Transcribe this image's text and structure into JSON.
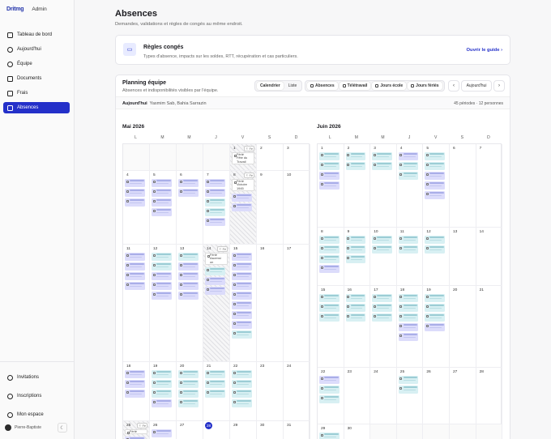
{
  "app": {
    "logo": "Dritmg",
    "section": "Admin"
  },
  "sidebar": {
    "items": [
      {
        "label": "Tableau de bord",
        "icon": "dashboard-icon",
        "active": false
      },
      {
        "label": "Aujourd'hui",
        "icon": "clock-icon",
        "active": false
      },
      {
        "label": "Équipe",
        "icon": "team-icon",
        "active": false
      },
      {
        "label": "Documents",
        "icon": "document-icon",
        "active": false
      },
      {
        "label": "Frais",
        "icon": "receipt-icon",
        "active": false
      },
      {
        "label": "Absences",
        "icon": "calendar-icon",
        "active": true
      }
    ],
    "bottom": [
      {
        "label": "Invitations",
        "icon": "invite-icon"
      },
      {
        "label": "Inscriptions",
        "icon": "signup-icon"
      },
      {
        "label": "Mon espace",
        "icon": "user-icon"
      }
    ],
    "user": "Pierre-Baptiste",
    "theme_icon": "☾"
  },
  "header": {
    "title": "Absences",
    "subtitle": "Demandes, validations et règles de congés au même endroit."
  },
  "rules": {
    "title": "Règles congés",
    "description": "Types d'absence, impacts sur les soldes, RTT, récupération et cas particuliers.",
    "link": "Ouvrir le guide"
  },
  "planning": {
    "title": "Planning équipe",
    "subtitle": "Absences et indisponibilités visibles par l'équipe.",
    "views": [
      "Calendrier",
      "Liste"
    ],
    "filters": [
      "Absences",
      "Télétravail",
      "Jours école",
      "Jours fériés"
    ],
    "today_button": "Aujourd'hui",
    "prev": "‹",
    "next": "›",
    "summary_label": "Aujourd'hui",
    "summary_people": "Yasmim Sab, Bahia Sarrazin",
    "summary_count": "45 périodes · 12 personnes"
  },
  "weekdays": [
    "L",
    "M",
    "M",
    "J",
    "V",
    "S",
    "D"
  ],
  "months": [
    {
      "title": "Mai 2026",
      "rows": [
        [
          "",
          "",
          "",
          "",
          "1",
          "2",
          "3"
        ],
        [
          "4",
          "5",
          "6",
          "7",
          "8",
          "9",
          "10"
        ],
        [
          "11",
          "12",
          "13",
          "14",
          "15",
          "16",
          "17"
        ],
        [
          "18",
          "19",
          "20",
          "21",
          "22",
          "23",
          "24"
        ],
        [
          "25",
          "26",
          "27",
          "28",
          "29",
          "30",
          "31"
        ]
      ],
      "holidays": [
        {
          "day": "1",
          "name": "Férié\nFête du\nTravail"
        },
        {
          "day": "8",
          "name": "Férié\nVictoire\n1945"
        },
        {
          "day": "14",
          "name": "Férié\nAscensi\non"
        },
        {
          "day": "25",
          "name": "Férié"
        }
      ],
      "today": "28",
      "events": {
        "4": [
          "p",
          "p",
          "p"
        ],
        "5": [
          "p",
          "p",
          "p",
          "p"
        ],
        "6": [
          "p",
          "p"
        ],
        "7": [
          "p",
          "p",
          "t",
          "t",
          "p"
        ],
        "8": [
          "p",
          "p"
        ],
        "11": [
          "p",
          "p",
          "p",
          "p"
        ],
        "12": [
          "t",
          "t",
          "p",
          "p",
          "p"
        ],
        "13": [
          "t",
          "p",
          "p",
          "p",
          "p"
        ],
        "14": [
          "t",
          "p",
          "p"
        ],
        "15": [
          "p",
          "p",
          "p",
          "p",
          "p",
          "p",
          "p",
          "p",
          "t"
        ],
        "18": [
          "p",
          "p",
          "p"
        ],
        "19": [
          "t",
          "t",
          "t",
          "p"
        ],
        "20": [
          "t",
          "t",
          "t",
          "t"
        ],
        "21": [
          "t",
          "t",
          "t"
        ],
        "22": [
          "t",
          "t",
          "t",
          "t"
        ],
        "25": [
          "p",
          "p"
        ],
        "26": [
          "p",
          "p"
        ]
      }
    },
    {
      "title": "Juin 2026",
      "rows": [
        [
          "1",
          "2",
          "3",
          "4",
          "5",
          "6",
          "7"
        ],
        [
          "8",
          "9",
          "10",
          "11",
          "12",
          "13",
          "14"
        ],
        [
          "15",
          "16",
          "17",
          "18",
          "19",
          "20",
          "21"
        ],
        [
          "22",
          "23",
          "24",
          "25",
          "26",
          "27",
          "28"
        ],
        [
          "29",
          "30",
          "",
          "",
          "",
          "",
          ""
        ]
      ],
      "holidays": [],
      "today": "",
      "events": {
        "1": [
          "t",
          "t",
          "p",
          "p"
        ],
        "2": [
          "t",
          "t"
        ],
        "3": [
          "t",
          "t"
        ],
        "4": [
          "p",
          "t",
          "t"
        ],
        "5": [
          "t",
          "t",
          "p",
          "p",
          "p"
        ],
        "8": [
          "t",
          "t",
          "t",
          "p"
        ],
        "9": [
          "t",
          "t",
          "t"
        ],
        "10": [
          "t",
          "t"
        ],
        "11": [
          "t",
          "t"
        ],
        "12": [
          "t",
          "t"
        ],
        "15": [
          "t",
          "t",
          "t"
        ],
        "16": [
          "t",
          "t",
          "t"
        ],
        "17": [
          "t",
          "t",
          "t"
        ],
        "18": [
          "t",
          "t",
          "t",
          "p",
          "p"
        ],
        "19": [
          "t",
          "t",
          "t",
          "p"
        ],
        "22": [
          "p",
          "t",
          "t"
        ],
        "25": [
          "t",
          "t"
        ],
        "29": [
          "t",
          "t"
        ]
      }
    }
  ],
  "colors": {
    "accent": "#2430c9",
    "absence": "#dcdcfb",
    "telework": "#d8f0f3"
  }
}
